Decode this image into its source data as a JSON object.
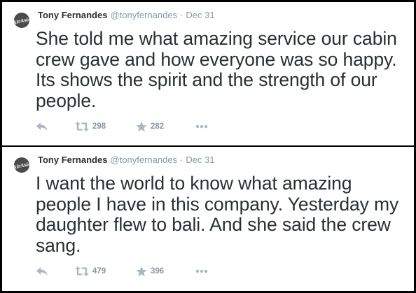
{
  "colors": {
    "frame": "#000000",
    "text": "#292f33",
    "muted": "#8899a6",
    "icon": "#aab8c2"
  },
  "tweets": [
    {
      "author_name": "Tony Fernandes",
      "author_handle": "@tonyfernandes",
      "separator": "·",
      "timestamp": "Dec 31",
      "avatar": {
        "icon": "airasia-logo-avatar",
        "label": "AirAsia"
      },
      "text": "She told me what amazing service our cabin crew gave and how everyone was so happy. Its shows the spirit and the strength of our people.",
      "actions": {
        "reply_icon": "reply-arrow-icon",
        "retweet_icon": "retweet-icon",
        "retweet_count": "298",
        "favorite_icon": "star-icon",
        "favorite_count": "282",
        "more_icon": "ellipsis-icon"
      }
    },
    {
      "author_name": "Tony Fernandes",
      "author_handle": "@tonyfernandes",
      "separator": "·",
      "timestamp": "Dec 31",
      "avatar": {
        "icon": "airasia-logo-avatar",
        "label": "AirAsia"
      },
      "text": "I want the world to know what amazing people I have in this company. Yesterday my daughter flew to bali. And she said the crew sang.",
      "actions": {
        "reply_icon": "reply-arrow-icon",
        "retweet_icon": "retweet-icon",
        "retweet_count": "479",
        "favorite_icon": "star-icon",
        "favorite_count": "396",
        "more_icon": "ellipsis-icon"
      }
    }
  ]
}
